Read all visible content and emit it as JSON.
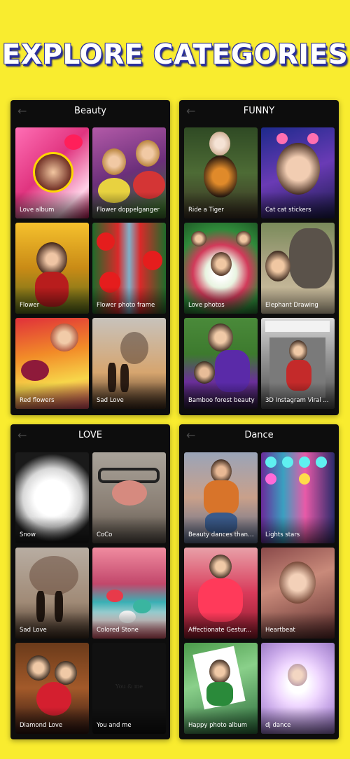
{
  "headline": "EXPLORE CATEGORIES",
  "panels": [
    {
      "title": "Beauty",
      "tiles": [
        {
          "label": "Love album"
        },
        {
          "label": "Flower doppelganger"
        },
        {
          "label": "Flower"
        },
        {
          "label": "Flower photo frame"
        },
        {
          "label": "Red flowers"
        },
        {
          "label": "Sad Love"
        }
      ]
    },
    {
      "title": "FUNNY",
      "tiles": [
        {
          "label": "Ride a Tiger"
        },
        {
          "label": "Cat cat stickers"
        },
        {
          "label": "Love photos"
        },
        {
          "label": "Elephant Drawing"
        },
        {
          "label": "Bamboo forest beauty"
        },
        {
          "label": "3D Instagram Viral ..."
        }
      ]
    },
    {
      "title": "LOVE",
      "tiles": [
        {
          "label": "Snow"
        },
        {
          "label": "CoCo"
        },
        {
          "label": "Sad Love"
        },
        {
          "label": "Colored Stone"
        },
        {
          "label": "Diamond Love"
        },
        {
          "label": "You and me"
        }
      ]
    },
    {
      "title": "Dance",
      "tiles": [
        {
          "label": "Beauty dances than ..."
        },
        {
          "label": "Lights stars"
        },
        {
          "label": "Affectionate Gestur..."
        },
        {
          "label": "Heartbeat"
        },
        {
          "label": "Happy photo album"
        },
        {
          "label": "dj dance"
        }
      ]
    }
  ],
  "you_and_me_overlay": "You & me",
  "icons": {
    "back": "back-arrow-icon"
  },
  "colors": {
    "background": "#f9ec2f",
    "panel": "#0d0d0d",
    "headline_outline": "#2a2f9c"
  }
}
